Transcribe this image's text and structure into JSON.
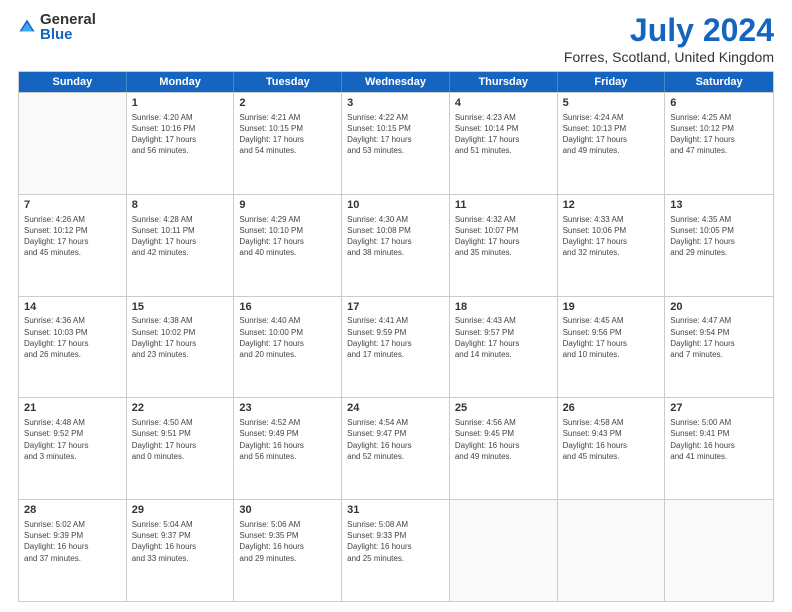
{
  "header": {
    "logo_general": "General",
    "logo_blue": "Blue",
    "title": "July 2024",
    "subtitle": "Forres, Scotland, United Kingdom"
  },
  "weekdays": [
    "Sunday",
    "Monday",
    "Tuesday",
    "Wednesday",
    "Thursday",
    "Friday",
    "Saturday"
  ],
  "weeks": [
    [
      {
        "day": "",
        "info": ""
      },
      {
        "day": "1",
        "info": "Sunrise: 4:20 AM\nSunset: 10:16 PM\nDaylight: 17 hours\nand 56 minutes."
      },
      {
        "day": "2",
        "info": "Sunrise: 4:21 AM\nSunset: 10:15 PM\nDaylight: 17 hours\nand 54 minutes."
      },
      {
        "day": "3",
        "info": "Sunrise: 4:22 AM\nSunset: 10:15 PM\nDaylight: 17 hours\nand 53 minutes."
      },
      {
        "day": "4",
        "info": "Sunrise: 4:23 AM\nSunset: 10:14 PM\nDaylight: 17 hours\nand 51 minutes."
      },
      {
        "day": "5",
        "info": "Sunrise: 4:24 AM\nSunset: 10:13 PM\nDaylight: 17 hours\nand 49 minutes."
      },
      {
        "day": "6",
        "info": "Sunrise: 4:25 AM\nSunset: 10:12 PM\nDaylight: 17 hours\nand 47 minutes."
      }
    ],
    [
      {
        "day": "7",
        "info": "Sunrise: 4:26 AM\nSunset: 10:12 PM\nDaylight: 17 hours\nand 45 minutes."
      },
      {
        "day": "8",
        "info": "Sunrise: 4:28 AM\nSunset: 10:11 PM\nDaylight: 17 hours\nand 42 minutes."
      },
      {
        "day": "9",
        "info": "Sunrise: 4:29 AM\nSunset: 10:10 PM\nDaylight: 17 hours\nand 40 minutes."
      },
      {
        "day": "10",
        "info": "Sunrise: 4:30 AM\nSunset: 10:08 PM\nDaylight: 17 hours\nand 38 minutes."
      },
      {
        "day": "11",
        "info": "Sunrise: 4:32 AM\nSunset: 10:07 PM\nDaylight: 17 hours\nand 35 minutes."
      },
      {
        "day": "12",
        "info": "Sunrise: 4:33 AM\nSunset: 10:06 PM\nDaylight: 17 hours\nand 32 minutes."
      },
      {
        "day": "13",
        "info": "Sunrise: 4:35 AM\nSunset: 10:05 PM\nDaylight: 17 hours\nand 29 minutes."
      }
    ],
    [
      {
        "day": "14",
        "info": "Sunrise: 4:36 AM\nSunset: 10:03 PM\nDaylight: 17 hours\nand 26 minutes."
      },
      {
        "day": "15",
        "info": "Sunrise: 4:38 AM\nSunset: 10:02 PM\nDaylight: 17 hours\nand 23 minutes."
      },
      {
        "day": "16",
        "info": "Sunrise: 4:40 AM\nSunset: 10:00 PM\nDaylight: 17 hours\nand 20 minutes."
      },
      {
        "day": "17",
        "info": "Sunrise: 4:41 AM\nSunset: 9:59 PM\nDaylight: 17 hours\nand 17 minutes."
      },
      {
        "day": "18",
        "info": "Sunrise: 4:43 AM\nSunset: 9:57 PM\nDaylight: 17 hours\nand 14 minutes."
      },
      {
        "day": "19",
        "info": "Sunrise: 4:45 AM\nSunset: 9:56 PM\nDaylight: 17 hours\nand 10 minutes."
      },
      {
        "day": "20",
        "info": "Sunrise: 4:47 AM\nSunset: 9:54 PM\nDaylight: 17 hours\nand 7 minutes."
      }
    ],
    [
      {
        "day": "21",
        "info": "Sunrise: 4:48 AM\nSunset: 9:52 PM\nDaylight: 17 hours\nand 3 minutes."
      },
      {
        "day": "22",
        "info": "Sunrise: 4:50 AM\nSunset: 9:51 PM\nDaylight: 17 hours\nand 0 minutes."
      },
      {
        "day": "23",
        "info": "Sunrise: 4:52 AM\nSunset: 9:49 PM\nDaylight: 16 hours\nand 56 minutes."
      },
      {
        "day": "24",
        "info": "Sunrise: 4:54 AM\nSunset: 9:47 PM\nDaylight: 16 hours\nand 52 minutes."
      },
      {
        "day": "25",
        "info": "Sunrise: 4:56 AM\nSunset: 9:45 PM\nDaylight: 16 hours\nand 49 minutes."
      },
      {
        "day": "26",
        "info": "Sunrise: 4:58 AM\nSunset: 9:43 PM\nDaylight: 16 hours\nand 45 minutes."
      },
      {
        "day": "27",
        "info": "Sunrise: 5:00 AM\nSunset: 9:41 PM\nDaylight: 16 hours\nand 41 minutes."
      }
    ],
    [
      {
        "day": "28",
        "info": "Sunrise: 5:02 AM\nSunset: 9:39 PM\nDaylight: 16 hours\nand 37 minutes."
      },
      {
        "day": "29",
        "info": "Sunrise: 5:04 AM\nSunset: 9:37 PM\nDaylight: 16 hours\nand 33 minutes."
      },
      {
        "day": "30",
        "info": "Sunrise: 5:06 AM\nSunset: 9:35 PM\nDaylight: 16 hours\nand 29 minutes."
      },
      {
        "day": "31",
        "info": "Sunrise: 5:08 AM\nSunset: 9:33 PM\nDaylight: 16 hours\nand 25 minutes."
      },
      {
        "day": "",
        "info": ""
      },
      {
        "day": "",
        "info": ""
      },
      {
        "day": "",
        "info": ""
      }
    ]
  ]
}
